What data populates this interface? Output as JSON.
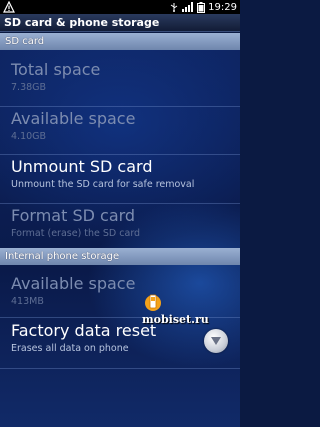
{
  "status_bar": {
    "time": "19:29",
    "icons": [
      "warning-icon",
      "usb-icon",
      "signal-icon",
      "battery-icon"
    ]
  },
  "title_bar": {
    "title": "SD card & phone storage"
  },
  "sections": {
    "sd_card": {
      "header": "SD card",
      "total_space": {
        "title": "Total space",
        "value": "7.38GB"
      },
      "available_space": {
        "title": "Available space",
        "value": "4.10GB"
      },
      "unmount": {
        "title": "Unmount SD card",
        "summary": "Unmount the SD card for safe removal"
      },
      "format": {
        "title": "Format SD card",
        "summary": "Format (erase) the SD card"
      }
    },
    "internal": {
      "header": "Internal phone storage",
      "available_space": {
        "title": "Available space",
        "value": "413MB"
      },
      "factory_reset": {
        "title": "Factory data reset",
        "summary": "Erases all data on phone"
      }
    }
  },
  "watermark": {
    "text": "mobiset.ru"
  },
  "colors": {
    "background": "#0b1a42",
    "section_header": "#8ea4c8",
    "disabled_text": "#7c8cb0",
    "summary_text": "#b7c4de"
  }
}
